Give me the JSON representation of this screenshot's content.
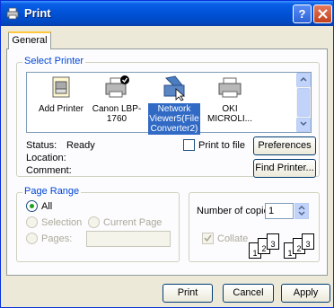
{
  "window": {
    "title": "Print",
    "help_label": "?",
    "close_label": "X"
  },
  "tabs": [
    {
      "label": "General"
    }
  ],
  "select_printer": {
    "title": "Select Printer",
    "printers": [
      {
        "label": "Add Printer",
        "icon": "add-printer-icon"
      },
      {
        "label": "Canon LBP-1760",
        "icon": "printer-default-icon"
      },
      {
        "label": "Network Viewer5(File Converter2)",
        "icon": "network-printer-icon",
        "selected": true
      },
      {
        "label": "OKI MICROLI...",
        "icon": "printer-icon"
      }
    ],
    "status_label": "Status:",
    "status_value": "Ready",
    "location_label": "Location:",
    "comment_label": "Comment:",
    "print_to_file_label": "Print to file",
    "preferences_label": "Preferences",
    "find_printer_label": "Find Printer..."
  },
  "page_range": {
    "title": "Page Range",
    "all_label": "All",
    "selection_label": "Selection",
    "current_page_label": "Current Page",
    "pages_label": "Pages:",
    "pages_value": ""
  },
  "copies": {
    "number_label": "Number of copies:",
    "number_value": "1",
    "collate_label": "Collate",
    "collate_pages": [
      "1",
      "2",
      "3",
      "1",
      "2",
      "3"
    ]
  },
  "buttons": {
    "print": "Print",
    "cancel": "Cancel",
    "apply": "Apply"
  },
  "colors": {
    "titlebar": "#0052d6",
    "selection": "#316ac5",
    "group_title": "#0046d5"
  }
}
